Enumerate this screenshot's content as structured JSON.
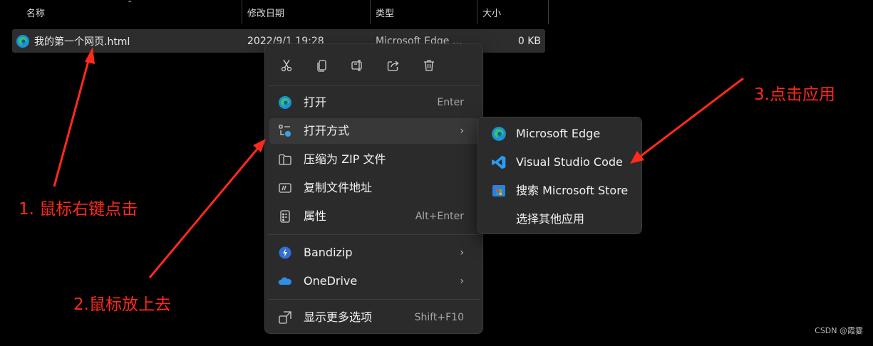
{
  "columns": {
    "name": "名称",
    "modified": "修改日期",
    "type": "类型",
    "size": "大小"
  },
  "file": {
    "icon": "edge-icon",
    "name": "我的第一个网页.html",
    "modified": "2022/9/1 19:28",
    "type": "Microsoft Edge ...",
    "size": "0 KB"
  },
  "context_menu": {
    "toolbar": [
      "cut-icon",
      "copy-icon",
      "rename-icon",
      "share-icon",
      "delete-icon"
    ],
    "items": [
      {
        "icon": "edge-icon",
        "label": "打开",
        "shortcut": "Enter"
      },
      {
        "icon": "open-with-icon",
        "label": "打开方式",
        "submenu": true
      },
      {
        "icon": "zip-folder-icon",
        "label": "压缩为 ZIP 文件"
      },
      {
        "icon": "copy-path-icon",
        "label": "复制文件地址"
      },
      {
        "icon": "properties-icon",
        "label": "属性",
        "shortcut": "Alt+Enter"
      },
      {
        "icon": "bandizip-icon",
        "label": "Bandizip",
        "submenu": true
      },
      {
        "icon": "onedrive-icon",
        "label": "OneDrive",
        "submenu": true
      },
      {
        "icon": "more-options-icon",
        "label": "显示更多选项",
        "shortcut": "Shift+F10"
      }
    ]
  },
  "open_with_submenu": {
    "items": [
      {
        "icon": "edge-icon",
        "label": "Microsoft Edge"
      },
      {
        "icon": "vscode-icon",
        "label": "Visual Studio Code"
      },
      {
        "icon": "microsoft-store-icon",
        "label": "搜索 Microsoft Store"
      },
      {
        "icon": "",
        "label": "选择其他应用"
      }
    ]
  },
  "annotations": {
    "step1": "1. 鼠标右键点击",
    "step2": "2.鼠标放上去",
    "step3": "3.点击应用"
  },
  "watermark": "CSDN @霞霎",
  "colors": {
    "annotation_red": "#ff2a1c",
    "menu_bg": "#2b2b2b",
    "hover_bg": "#383838",
    "row_selected": "#2d2d2d",
    "vscode_blue": "#2a9df4"
  }
}
